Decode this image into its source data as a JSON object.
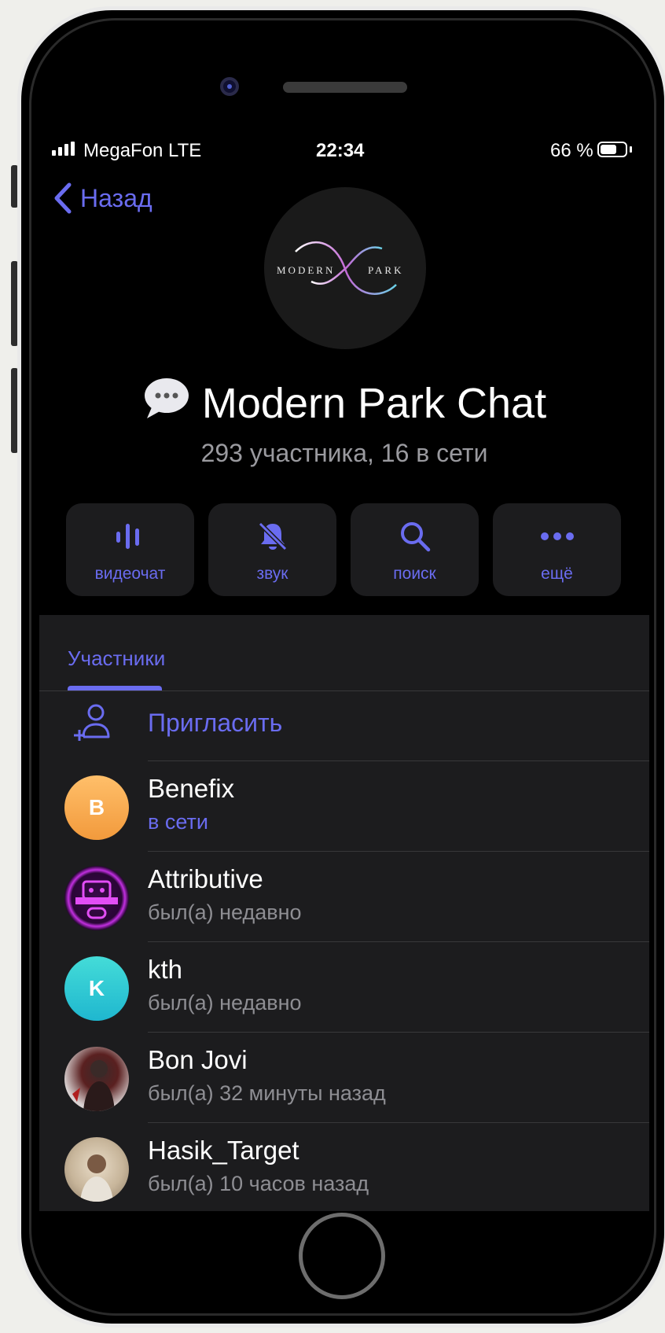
{
  "status_bar": {
    "carrier": "MegaFon  LTE",
    "time": "22:34",
    "battery_percent": "66 %",
    "battery_level": 0.66
  },
  "nav": {
    "back_label": "Назад"
  },
  "chat": {
    "logo_left": "MODERN",
    "logo_right": "PARK",
    "title": "Modern Park Chat",
    "subtitle": "293 участника, 16 в сети"
  },
  "actions": [
    {
      "label": "видеочат",
      "icon": "voice-chat-icon"
    },
    {
      "label": "звук",
      "icon": "bell-muted-icon"
    },
    {
      "label": "поиск",
      "icon": "search-icon"
    },
    {
      "label": "ещё",
      "icon": "more-dots-icon"
    }
  ],
  "tabs": {
    "members_label": "Участники"
  },
  "invite": {
    "label": "Пригласить",
    "icon": "add-user-icon"
  },
  "members": [
    {
      "name": "Benefix",
      "status": "в сети",
      "initial": "B",
      "online": true,
      "avatar_color": "#f5a24a"
    },
    {
      "name": "Attributive",
      "status": "был(а) недавно",
      "initial": "",
      "online": false,
      "avatar_color": "#a32bd8"
    },
    {
      "name": "kth",
      "status": "был(а) недавно",
      "initial": "K",
      "online": false,
      "avatar_color": "#32c9d0"
    },
    {
      "name": "Bon Jovi",
      "status": "был(а) 32 минуты назад",
      "initial": "",
      "online": false,
      "avatar_color": "#8a6b6b"
    },
    {
      "name": "Hasik_Target",
      "status": "был(а) 10 часов назад",
      "initial": "",
      "online": false,
      "avatar_color": "#b7a48c"
    }
  ],
  "colors": {
    "accent": "#6a6cf0",
    "panel": "#1c1c1e",
    "background": "#000000"
  }
}
